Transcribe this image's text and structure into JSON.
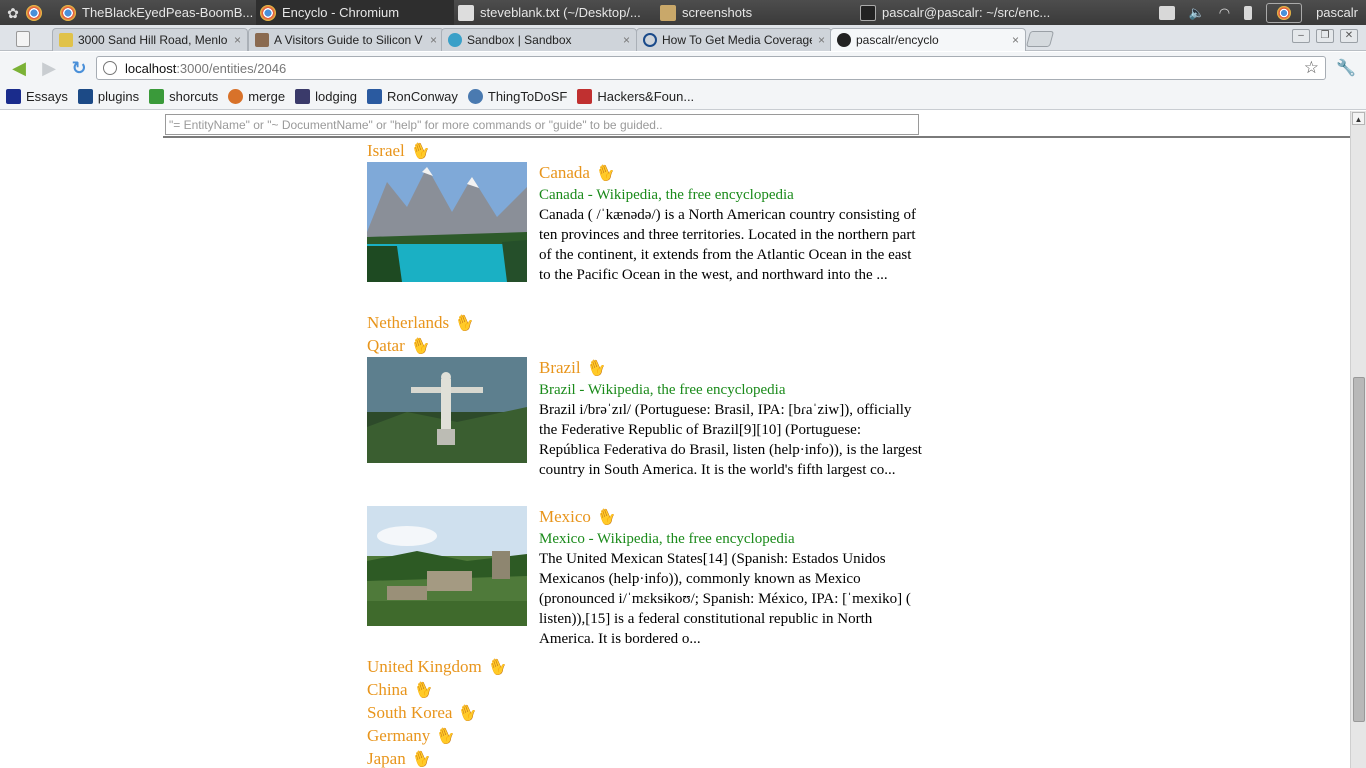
{
  "os_panel": {
    "tasks": [
      {
        "label": "TheBlackEyedPeas-BoomB...",
        "icon": "chrome-icon"
      },
      {
        "label": "Encyclo - Chromium",
        "icon": "chrome-icon"
      },
      {
        "label": "steveblank.txt (~/Desktop/...",
        "icon": "text-editor-icon"
      },
      {
        "label": "screenshots",
        "icon": "folder-icon"
      },
      {
        "label": "pascalr@pascalr: ~/src/enc...",
        "icon": "terminal-icon"
      }
    ],
    "user": "pascalr"
  },
  "tabs": [
    {
      "title": "3000 Sand Hill Road, Menlo",
      "close": "×"
    },
    {
      "title": "A Visitors Guide to Silicon V",
      "close": "×"
    },
    {
      "title": "Sandbox | Sandbox",
      "close": "×"
    },
    {
      "title": "How To Get Media Coverage",
      "close": "×"
    },
    {
      "title": "pascalr/encyclo",
      "close": "×"
    }
  ],
  "omnibox": {
    "host": "localhost",
    "path": ":3000/entities/2046"
  },
  "bookmarks": [
    {
      "label": "Essays",
      "color": "#1a2c8c"
    },
    {
      "label": "plugins",
      "color": "#1c4a86"
    },
    {
      "label": "shorcuts",
      "color": "#3a9a3a"
    },
    {
      "label": "merge",
      "color": "#d8722a"
    },
    {
      "label": "lodging",
      "color": "#3a3a6a"
    },
    {
      "label": "RonConway",
      "color": "#2a5aa0"
    },
    {
      "label": "ThingToDoSF",
      "color": "#4a7ab0"
    },
    {
      "label": "Hackers&Foun...",
      "color": "#c03030"
    }
  ],
  "command": {
    "placeholder": "\"= EntityName\" or \"~ DocumentName\" or \"help\" for more commands or \"guide\" to be guided.."
  },
  "entities_top": [
    {
      "name": "Israel"
    }
  ],
  "cards": [
    {
      "name": "Canada",
      "source": "Canada - Wikipedia, the free encyclopedia",
      "snippet": "Canada ( /ˈkænədə/) is a North American country consisting of ten provinces and three territories. Located in the northern part of the continent, it extends from the Atlantic Ocean in the east to the Pacific Ocean in the west, and northward into the ..."
    },
    {
      "name": "Brazil",
      "source": "Brazil - Wikipedia, the free encyclopedia",
      "snippet": "Brazil i/brəˈzɪl/ (Portuguese: Brasil, IPA: [bɾaˈziw]), officially the Federative Republic of Brazil[9][10] (Portuguese: República Federativa do Brasil,  listen (help·info)), is the largest country in South America. It is the world's fifth largest co..."
    },
    {
      "name": "Mexico",
      "source": "Mexico - Wikipedia, the free encyclopedia",
      "snippet": "The United Mexican States[14] (Spanish:  Estados Unidos Mexicanos (help·info)), commonly known as Mexico (pronounced i/ˈmɛksɨkoʊ/; Spanish: México, IPA: [ˈmexiko] ( listen)),[15] is a federal constitutional republic in North America. It is bordered o..."
    }
  ],
  "entities_middle": [
    {
      "name": "Netherlands"
    },
    {
      "name": "Qatar"
    }
  ],
  "entities_bottom": [
    {
      "name": "United Kingdom"
    },
    {
      "name": "China"
    },
    {
      "name": "South Korea"
    },
    {
      "name": "Germany"
    },
    {
      "name": "Japan"
    }
  ],
  "colors": {
    "entity": "#e8951c",
    "source": "#1a8a1a"
  }
}
